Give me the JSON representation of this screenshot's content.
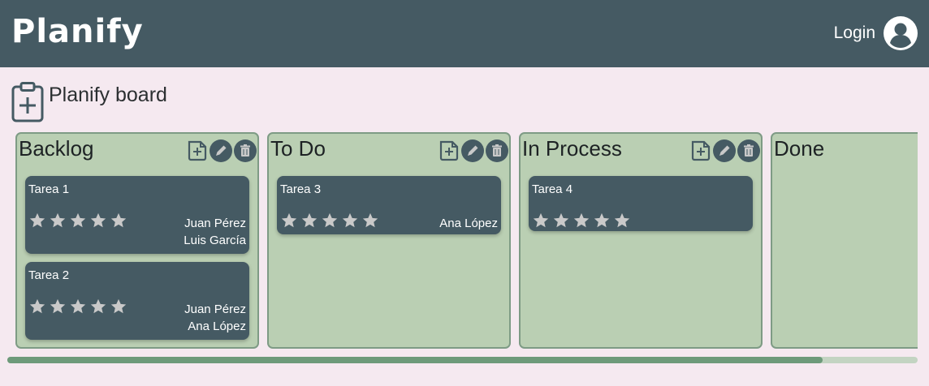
{
  "app": {
    "logo": "Planify"
  },
  "header": {
    "login_label": "Login",
    "avatar_icon": "user-circle-icon"
  },
  "board": {
    "title": "Planify board",
    "icon": "clipboard-plus-icon"
  },
  "colors": {
    "topbar": "#455a63",
    "page_bg": "#f5e9f0",
    "column_bg": "#bacfb3",
    "column_border": "#7e9b85",
    "card_bg": "#455a63",
    "star": "#c9c9c9",
    "scroll_thumb": "#6d9a7a",
    "scroll_track": "#c3d4c2"
  },
  "columns": [
    {
      "title": "Backlog",
      "actions": [
        "add-card-icon",
        "edit-icon",
        "trash-icon"
      ],
      "cards": [
        {
          "title": "Tarea 1",
          "rating": 0,
          "assignees": [
            "Juan Pérez",
            "Luis García"
          ]
        },
        {
          "title": "Tarea 2",
          "rating": 0,
          "assignees": [
            "Juan Pérez",
            "Ana López"
          ]
        }
      ]
    },
    {
      "title": "To Do",
      "actions": [
        "add-card-icon",
        "edit-icon",
        "trash-icon"
      ],
      "cards": [
        {
          "title": "Tarea 3",
          "rating": 0,
          "assignees": [
            "Ana López"
          ]
        }
      ]
    },
    {
      "title": "In Process",
      "actions": [
        "add-card-icon",
        "edit-icon",
        "trash-icon"
      ],
      "cards": [
        {
          "title": "Tarea 4",
          "rating": 0,
          "assignees": []
        }
      ]
    },
    {
      "title": "Done",
      "actions": [],
      "cards": []
    }
  ],
  "scroll": {
    "position_fraction": 0.0,
    "visible_fraction": 0.9
  }
}
